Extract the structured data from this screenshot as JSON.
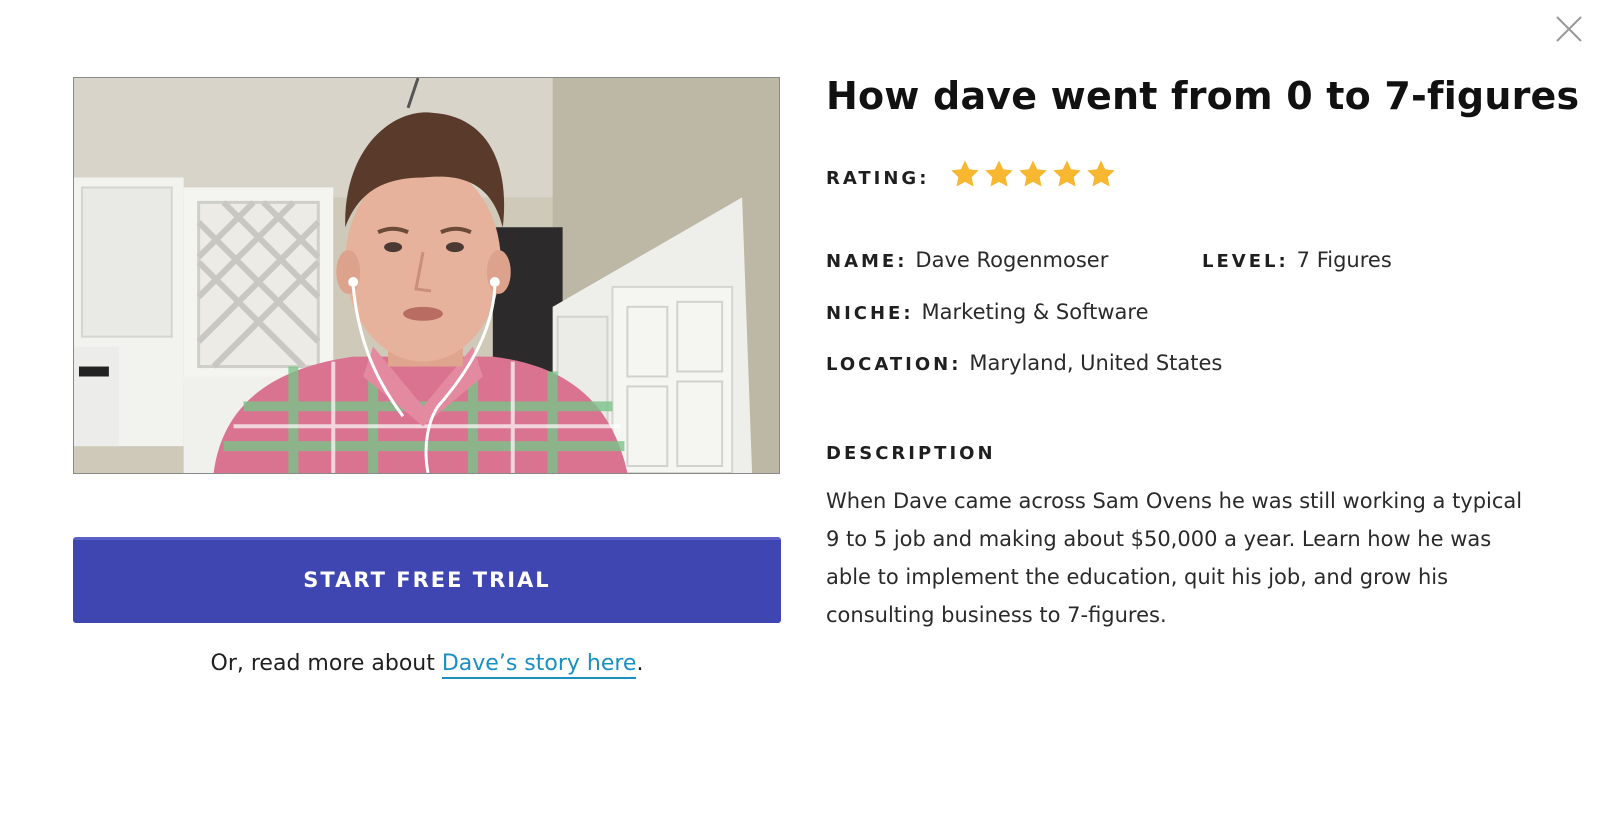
{
  "modal": {
    "close_icon": "close-icon"
  },
  "video": {
    "thumbnail": "video-thumbnail-man-in-plaid-shirt-kitchen"
  },
  "cta": {
    "button_label": "START FREE TRIAL",
    "read_more_prefix": "Or, read more about ",
    "read_more_link": "Dave’s story here",
    "read_more_suffix": "."
  },
  "profile": {
    "title": "How dave went from 0 to 7-figures",
    "rating_label": "RATING:",
    "rating_value": 5,
    "rating_max": 5,
    "star_color": "#f7b731",
    "name_label": "NAME:",
    "name": "Dave Rogenmoser",
    "level_label": "LEVEL:",
    "level": "7 Figures",
    "niche_label": "NICHE:",
    "niche": "Marketing & Software",
    "location_label": "LOCATION:",
    "location": "Maryland, United States",
    "description_label": "DESCRIPTION",
    "description": "When Dave came across Sam Ovens he was still working a typical 9 to 5 job and making about $50,000 a year. Learn how he was able to implement the education, quit his job, and grow his consulting business to 7-figures."
  },
  "colors": {
    "button_bg": "#3f45b1",
    "link": "#1a8fc4",
    "star": "#f7b731"
  }
}
